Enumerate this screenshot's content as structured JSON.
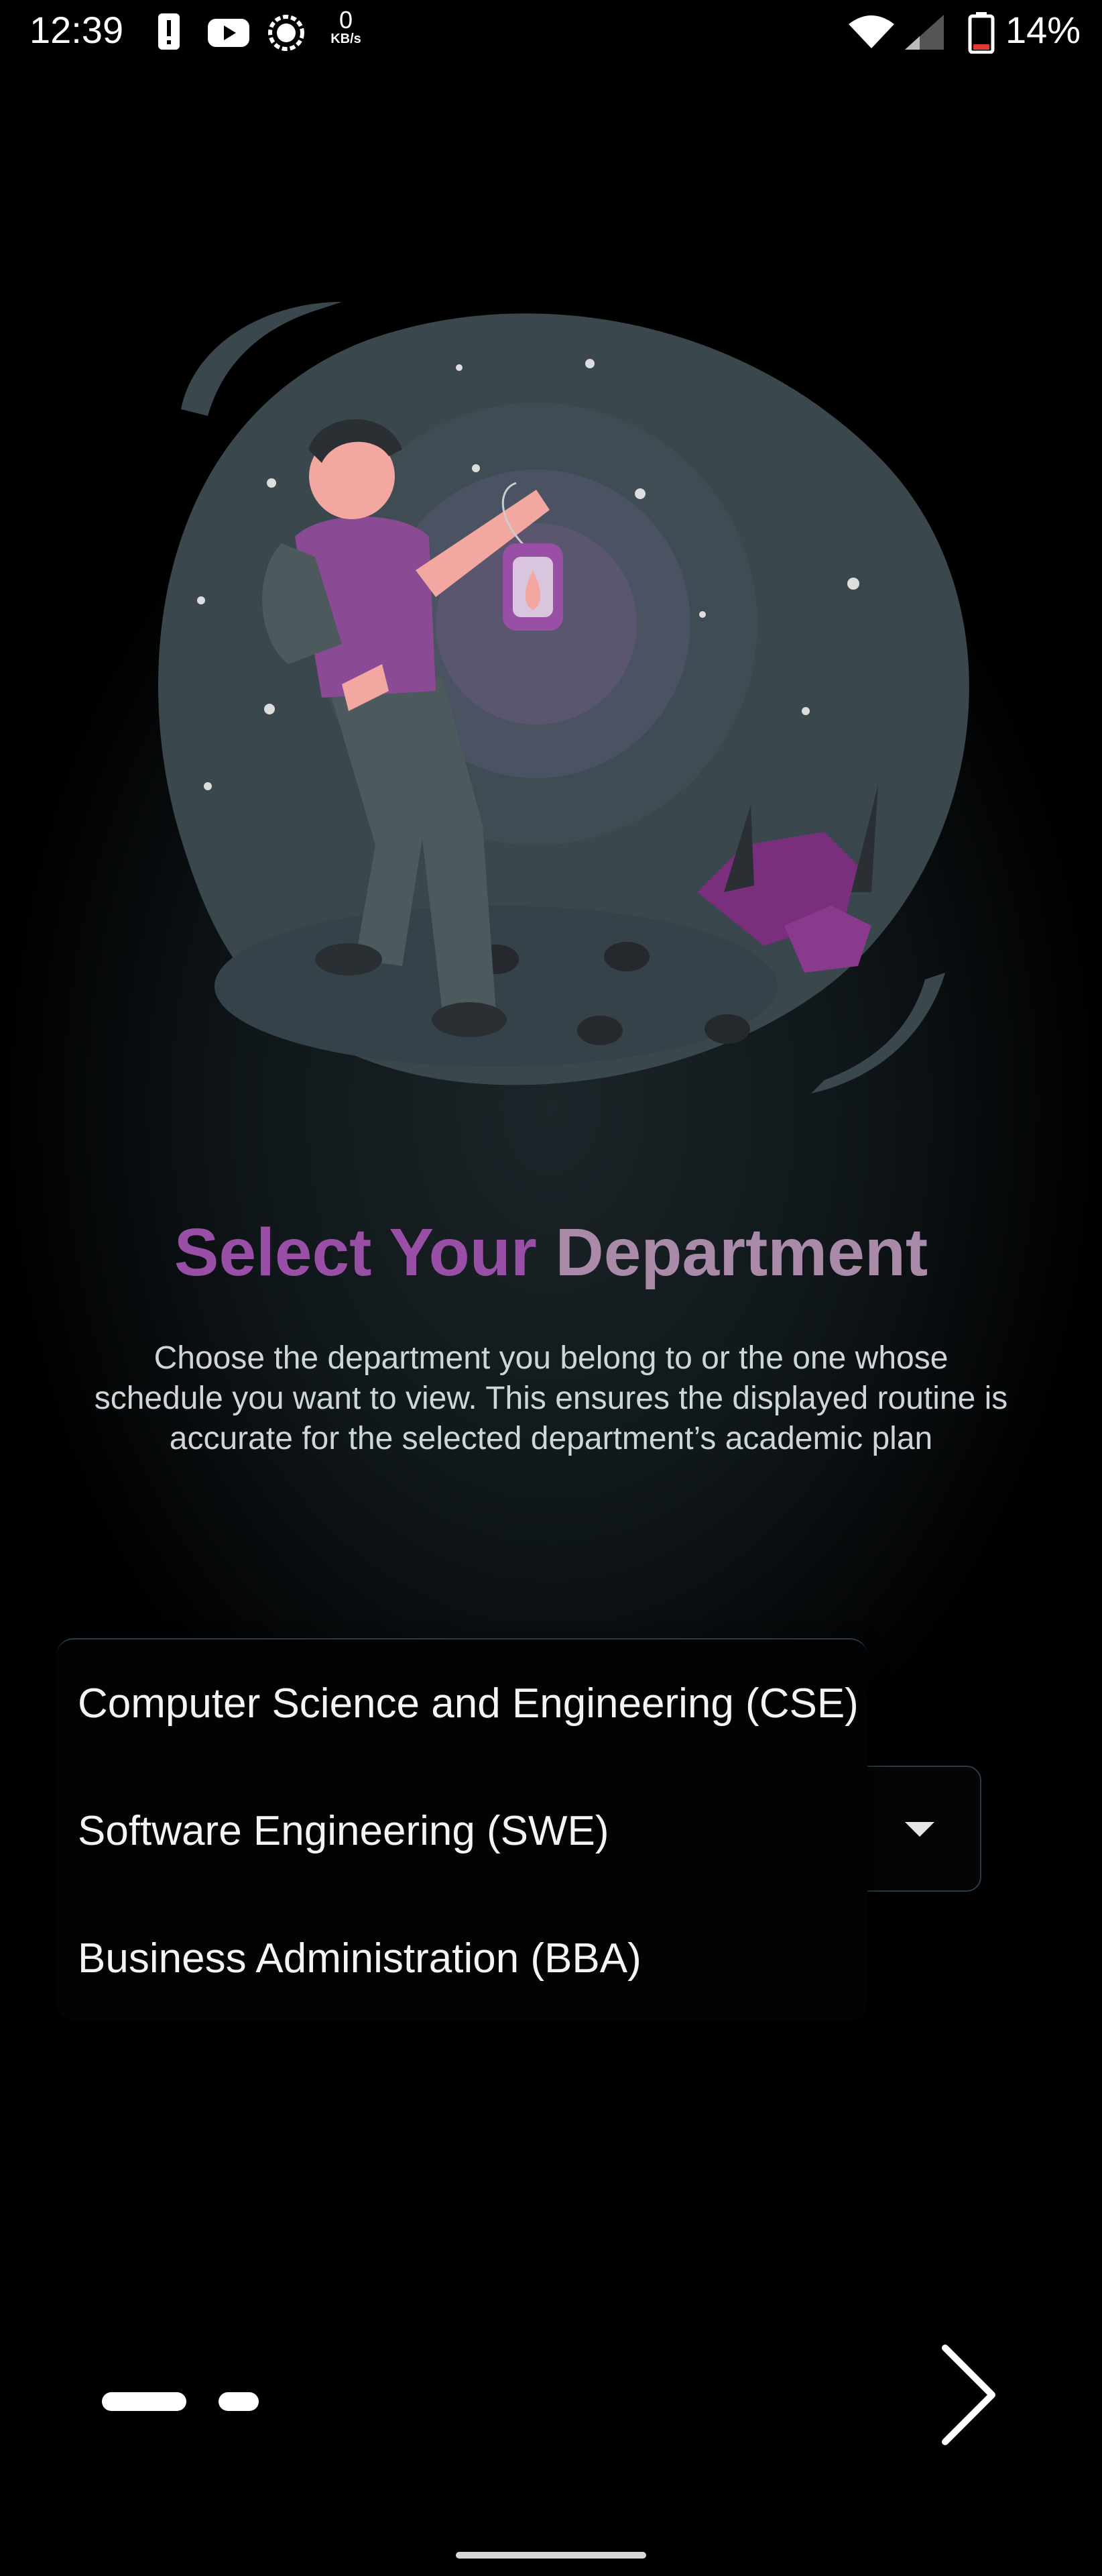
{
  "status_bar": {
    "time": "12:39",
    "network_speed_value": "0",
    "network_speed_unit": "KB/s",
    "battery_percent": "14%",
    "icons": [
      "alert-icon",
      "youtube-icon",
      "settings-icon",
      "wifi-icon",
      "signal-icon",
      "battery-icon"
    ]
  },
  "onboarding": {
    "title_part1": "Select Your",
    "title_part2": "Department",
    "description": "Choose the department you belong to or the one whose schedule you want to view. This ensures the displayed routine is accurate for the selected department’s academic plan",
    "illustration": "person-with-lantern-illustration"
  },
  "department_dropdown": {
    "options": [
      "Computer Science and Engineering (CSE)",
      "Software Engineering (SWE)",
      "Business Administration (BBA)"
    ]
  },
  "navigation": {
    "next_icon": "chevron-right-icon",
    "page_count": 2,
    "current_page": 1
  },
  "colors": {
    "title_accent": "#9a4fa6",
    "title_secondary": "#a98aa9",
    "background": "#000000"
  }
}
